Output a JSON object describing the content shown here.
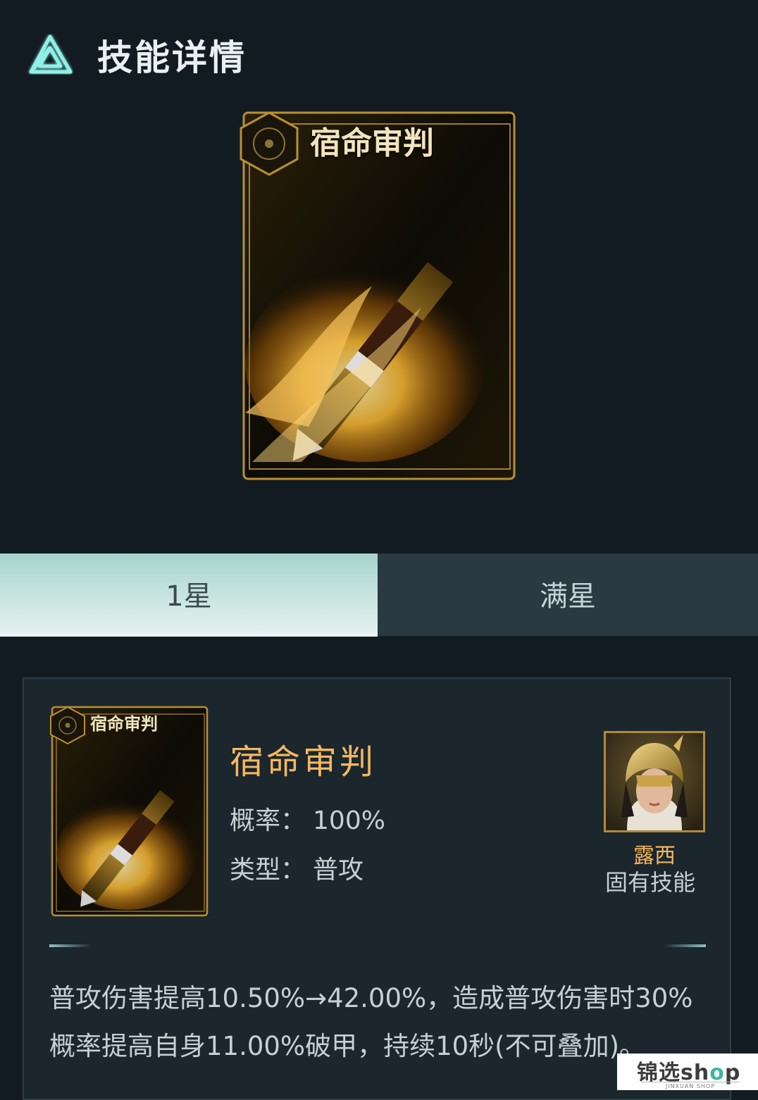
{
  "header": {
    "title": "技能详情",
    "icon": "triangle-logo-icon"
  },
  "card": {
    "title": "宿命审判",
    "emblem": "hexagon-flower-icon",
    "art": "flaming-bullet"
  },
  "tabs": [
    {
      "label": "1星",
      "active": true
    },
    {
      "label": "满星",
      "active": false
    }
  ],
  "skill": {
    "name": "宿命审判",
    "rate_label": "概率：",
    "rate_value": "100%",
    "type_label": "类型：",
    "type_value": "普攻",
    "description_line1": "普攻伤害提高10.50%→42.00%，造成普攻伤害时30%",
    "description_line2": "概率提高自身11.00%破甲，持续10秒(不可叠加)。"
  },
  "hero": {
    "name": "露西",
    "skill_type": "固有技能"
  },
  "watermark": {
    "brand_prefix": "锦选sh",
    "brand_o": "o",
    "brand_suffix": "p",
    "sub": "JINXUAN SHOP"
  },
  "colors": {
    "background": "#131b22",
    "accent_gold": "#f4b760",
    "tab_active": "#cde6e2",
    "tab_inactive": "#2a3a42"
  }
}
